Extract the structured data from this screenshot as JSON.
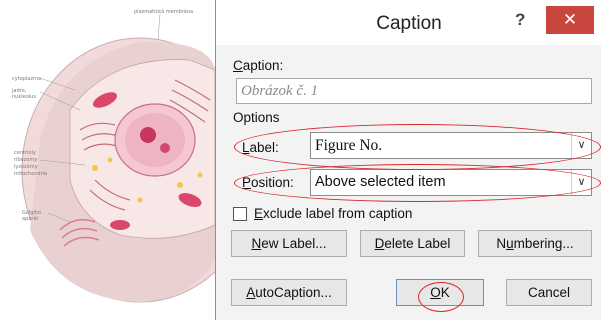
{
  "background": {
    "labels": [
      "plazmatická membrána",
      "cytoplazma",
      "jadro, nukleolus",
      "centrioly",
      "ribozomy",
      "lyzozómy",
      "mitochondria",
      "Golgiho aparát"
    ]
  },
  "dialog": {
    "title": "Caption",
    "help_glyph": "?",
    "close_glyph": "✕",
    "caption": {
      "label_prefix": "C",
      "label_rest": "aption:",
      "value": "Obrázok č. 1"
    },
    "options_heading": "Options",
    "label_field": {
      "label_prefix": "L",
      "label_rest": "abel:",
      "selected": "Figure No."
    },
    "position_field": {
      "label_prefix": "P",
      "label_rest": "osition:",
      "selected": "Above selected item"
    },
    "exclude_label": {
      "prefix": "E",
      "rest": "xclude label from caption",
      "checked": false
    },
    "buttons": {
      "new_label": {
        "prefix": "N",
        "rest": "ew Label..."
      },
      "delete_label": {
        "prefix": "D",
        "rest": "elete Label"
      },
      "numbering": {
        "pre": "N",
        "u": "u",
        "post": "mbering..."
      },
      "autocaption": {
        "prefix": "A",
        "rest": "utoCaption..."
      },
      "ok": {
        "prefix": "O",
        "rest": "K"
      },
      "cancel": "Cancel"
    },
    "annotation_color": "#d8292c"
  }
}
